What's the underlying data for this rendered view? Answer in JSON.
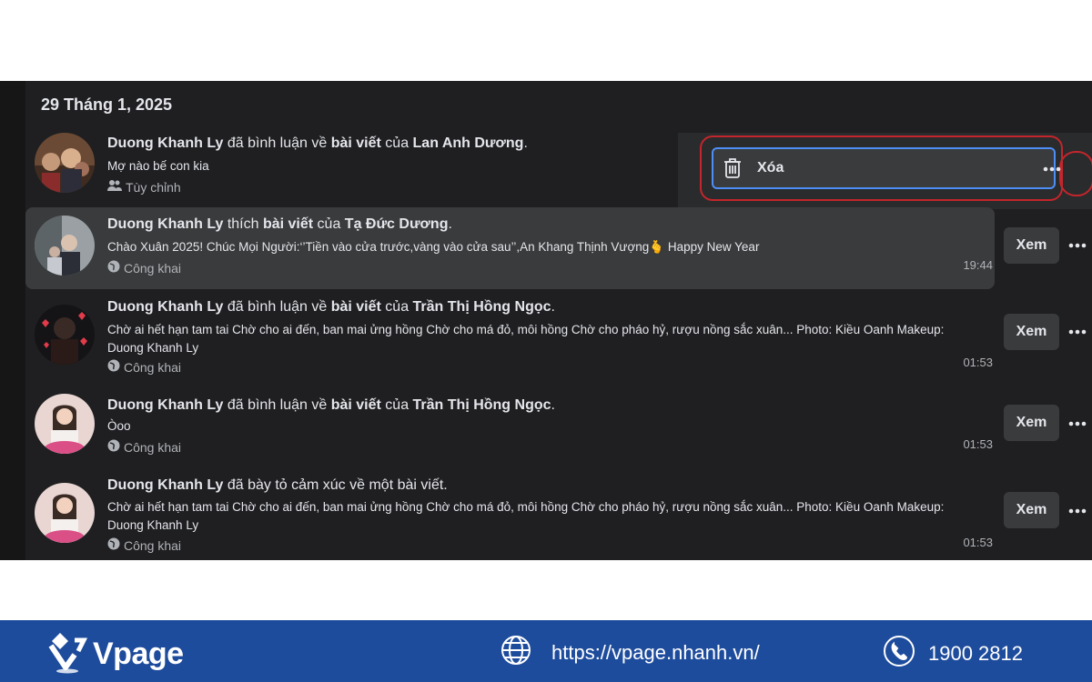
{
  "date_header": "29 Tháng 1, 2025",
  "context_menu": {
    "delete_label": "Xóa"
  },
  "activities": [
    {
      "actor": "Duong Khanh Ly",
      "verb": " đã bình luận về ",
      "object": "bài viết",
      "connector": " của ",
      "target": "Lan Anh Dương",
      "end": ".",
      "snippet": "Mợ nào bế con kia",
      "privacy": "Tùy chỉnh",
      "time": ""
    },
    {
      "actor": "Duong Khanh Ly",
      "verb": " thích ",
      "object": "bài viết",
      "connector": " của ",
      "target": "Tạ Đức Dương",
      "end": ".",
      "snippet": "Chào Xuân 2025! Chúc Mọi Người:‘’Tiền vào cửa trước,vàng vào cửa sau’’,An Khang Thịnh Vượng🫰 Happy New Year",
      "privacy": "Công khai",
      "time": "19:44",
      "view_label": "Xem"
    },
    {
      "actor": "Duong Khanh Ly",
      "verb": " đã bình luận về ",
      "object": "bài viết",
      "connector": " của ",
      "target": "Trần Thị Hồng Ngọc",
      "end": ".",
      "snippet": "Chờ ai hết hạn tam tai Chờ cho ai đến, ban mai ửng hồng Chờ cho má đỏ, môi hồng Chờ cho pháo hỷ, rượu nồng sắc xuân... Photo: Kiều Oanh Makeup: Duong Khanh Ly",
      "privacy": "Công khai",
      "time": "01:53",
      "view_label": "Xem"
    },
    {
      "actor": "Duong Khanh Ly",
      "verb": " đã bình luận về ",
      "object": "bài viết",
      "connector": " của ",
      "target": "Trần Thị Hồng Ngọc",
      "end": ".",
      "snippet": "Òoo",
      "privacy": "Công khai",
      "time": "01:53",
      "view_label": "Xem"
    },
    {
      "actor": "Duong Khanh Ly",
      "verb": " đã bày tỏ cảm xúc về một bài viết.",
      "object": "",
      "connector": "",
      "target": "",
      "end": "",
      "snippet": "Chờ ai hết hạn tam tai Chờ cho ai đến, ban mai ửng hồng Chờ cho má đỏ, môi hồng Chờ cho pháo hỷ, rượu nồng sắc xuân... Photo: Kiều Oanh Makeup: Duong Khanh Ly",
      "privacy": "Công khai",
      "time": "01:53",
      "view_label": "Xem"
    }
  ],
  "footer": {
    "brand": "Vpage",
    "website": "https://vpage.nhanh.vn/",
    "phone": "1900 2812"
  },
  "colors": {
    "panel_bg": "#1f1f21",
    "highlight_bg": "#3a3b3c",
    "text": "#e4e6eb",
    "muted_text": "#b0b3b8",
    "annotation_red": "#c3262c",
    "focus_blue": "#4e8ef7",
    "footer_bg": "#1e4c9c"
  },
  "icons": [
    "trash-icon",
    "more-options-icon",
    "friends-icon",
    "globe-icon",
    "phone-icon",
    "vpage-logo-icon"
  ]
}
